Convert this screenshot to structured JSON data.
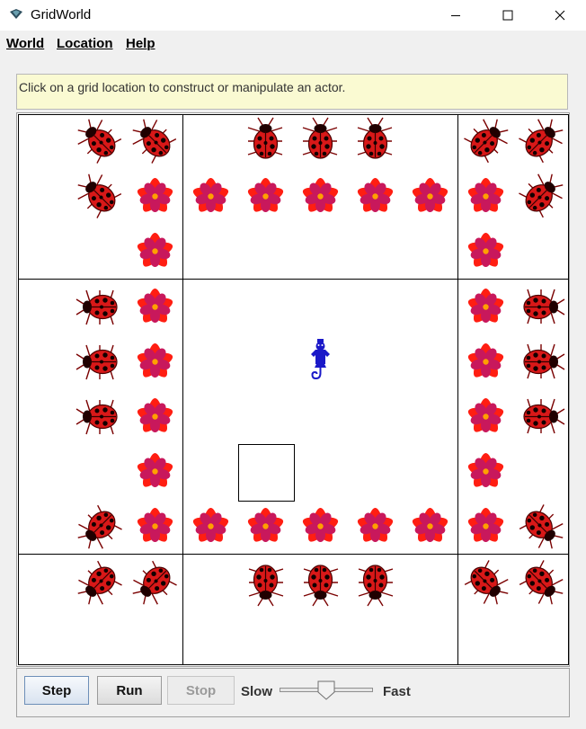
{
  "window": {
    "title": "GridWorld"
  },
  "menu": [
    "World",
    "Location",
    "Help"
  ],
  "message": "Click on a grid location to construct or manipulate an actor.",
  "grid": {
    "rows": 10,
    "cols": 10,
    "selected_cell": {
      "row": 6,
      "col": 4
    },
    "actors": [
      {
        "row": 0,
        "col": 1,
        "type": "bug",
        "dir": 315
      },
      {
        "row": 0,
        "col": 2,
        "type": "bug",
        "dir": 315
      },
      {
        "row": 0,
        "col": 4,
        "type": "bug",
        "dir": 0
      },
      {
        "row": 0,
        "col": 5,
        "type": "bug",
        "dir": 0
      },
      {
        "row": 0,
        "col": 6,
        "type": "bug",
        "dir": 0
      },
      {
        "row": 0,
        "col": 8,
        "type": "bug",
        "dir": 45
      },
      {
        "row": 0,
        "col": 9,
        "type": "bug",
        "dir": 45
      },
      {
        "row": 1,
        "col": 1,
        "type": "bug",
        "dir": 315
      },
      {
        "row": 1,
        "col": 2,
        "type": "flower"
      },
      {
        "row": 1,
        "col": 3,
        "type": "flower"
      },
      {
        "row": 1,
        "col": 4,
        "type": "flower"
      },
      {
        "row": 1,
        "col": 5,
        "type": "flower"
      },
      {
        "row": 1,
        "col": 6,
        "type": "flower"
      },
      {
        "row": 1,
        "col": 7,
        "type": "flower"
      },
      {
        "row": 1,
        "col": 8,
        "type": "flower"
      },
      {
        "row": 1,
        "col": 9,
        "type": "bug",
        "dir": 45
      },
      {
        "row": 2,
        "col": 2,
        "type": "flower"
      },
      {
        "row": 2,
        "col": 8,
        "type": "flower"
      },
      {
        "row": 3,
        "col": 1,
        "type": "bug",
        "dir": 270
      },
      {
        "row": 3,
        "col": 2,
        "type": "flower"
      },
      {
        "row": 3,
        "col": 8,
        "type": "flower"
      },
      {
        "row": 3,
        "col": 9,
        "type": "bug",
        "dir": 90
      },
      {
        "row": 4,
        "col": 1,
        "type": "bug",
        "dir": 270
      },
      {
        "row": 4,
        "col": 2,
        "type": "flower"
      },
      {
        "row": 4,
        "col": 5,
        "type": "critter"
      },
      {
        "row": 4,
        "col": 8,
        "type": "flower"
      },
      {
        "row": 4,
        "col": 9,
        "type": "bug",
        "dir": 90
      },
      {
        "row": 5,
        "col": 1,
        "type": "bug",
        "dir": 270
      },
      {
        "row": 5,
        "col": 2,
        "type": "flower"
      },
      {
        "row": 5,
        "col": 8,
        "type": "flower"
      },
      {
        "row": 5,
        "col": 9,
        "type": "bug",
        "dir": 90
      },
      {
        "row": 6,
        "col": 2,
        "type": "flower"
      },
      {
        "row": 6,
        "col": 8,
        "type": "flower"
      },
      {
        "row": 7,
        "col": 1,
        "type": "bug",
        "dir": 225
      },
      {
        "row": 7,
        "col": 2,
        "type": "flower"
      },
      {
        "row": 7,
        "col": 3,
        "type": "flower"
      },
      {
        "row": 7,
        "col": 4,
        "type": "flower"
      },
      {
        "row": 7,
        "col": 5,
        "type": "flower"
      },
      {
        "row": 7,
        "col": 6,
        "type": "flower"
      },
      {
        "row": 7,
        "col": 7,
        "type": "flower"
      },
      {
        "row": 7,
        "col": 8,
        "type": "flower"
      },
      {
        "row": 7,
        "col": 9,
        "type": "bug",
        "dir": 135
      },
      {
        "row": 8,
        "col": 1,
        "type": "bug",
        "dir": 225
      },
      {
        "row": 8,
        "col": 2,
        "type": "bug",
        "dir": 225
      },
      {
        "row": 8,
        "col": 4,
        "type": "bug",
        "dir": 180
      },
      {
        "row": 8,
        "col": 5,
        "type": "bug",
        "dir": 180
      },
      {
        "row": 8,
        "col": 6,
        "type": "bug",
        "dir": 180
      },
      {
        "row": 8,
        "col": 8,
        "type": "bug",
        "dir": 135
      },
      {
        "row": 8,
        "col": 9,
        "type": "bug",
        "dir": 135
      }
    ]
  },
  "controls": {
    "step_label": "Step",
    "run_label": "Run",
    "stop_label": "Stop",
    "slow_label": "Slow",
    "fast_label": "Fast",
    "speed_fraction": 0.5
  },
  "colors": {
    "bug_red": "#d81818",
    "flower_red": "#ff1e12",
    "flower_pink": "#c8185c",
    "flower_center": "#ffa000",
    "critter_blue": "#1a18c8",
    "message_bg": "#fafad2"
  }
}
